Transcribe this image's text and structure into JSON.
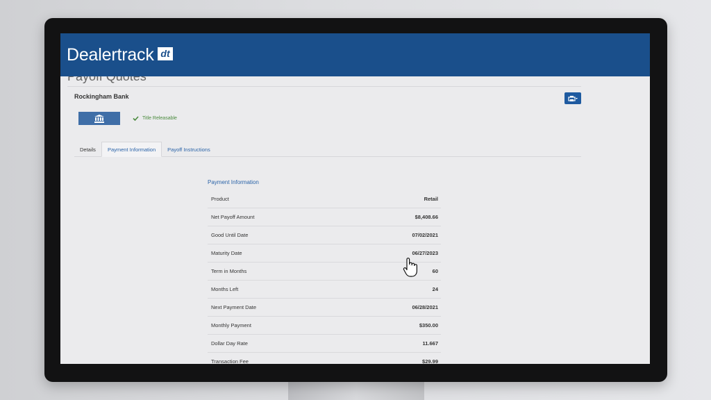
{
  "brand": {
    "name": "Dealertrack",
    "logo_text": "dt"
  },
  "page": {
    "title": "Payoff Quotes"
  },
  "lender": {
    "name": "Rockingham Bank",
    "title_status": "Title Releasable"
  },
  "tabs": [
    {
      "label": "Details"
    },
    {
      "label": "Payment Information"
    },
    {
      "label": "Payoff Instructions"
    }
  ],
  "payment_info": {
    "title": "Payment Information",
    "rows": [
      {
        "label": "Product",
        "value": "Retail"
      },
      {
        "label": "Net Payoff Amount",
        "value": "$8,408.66"
      },
      {
        "label": "Good Until Date",
        "value": "07/02/2021"
      },
      {
        "label": "Maturity Date",
        "value": "06/27/2023"
      },
      {
        "label": "Term in Months",
        "value": "60"
      },
      {
        "label": "Months Left",
        "value": "24"
      },
      {
        "label": "Next Payment Date",
        "value": "06/28/2021"
      },
      {
        "label": "Monthly Payment",
        "value": "$350.00"
      },
      {
        "label": "Dollar Day Rate",
        "value": "11.667"
      },
      {
        "label": "Transaction Fee",
        "value": "$29.99"
      }
    ]
  },
  "colors": {
    "brand_blue": "#1a4f8b",
    "link_blue": "#2a63a8",
    "success_green": "#4a8a3d"
  },
  "icons": {
    "print": "printer-icon",
    "bank": "bank-icon",
    "check": "check-icon",
    "cursor": "hand-pointer-icon"
  }
}
